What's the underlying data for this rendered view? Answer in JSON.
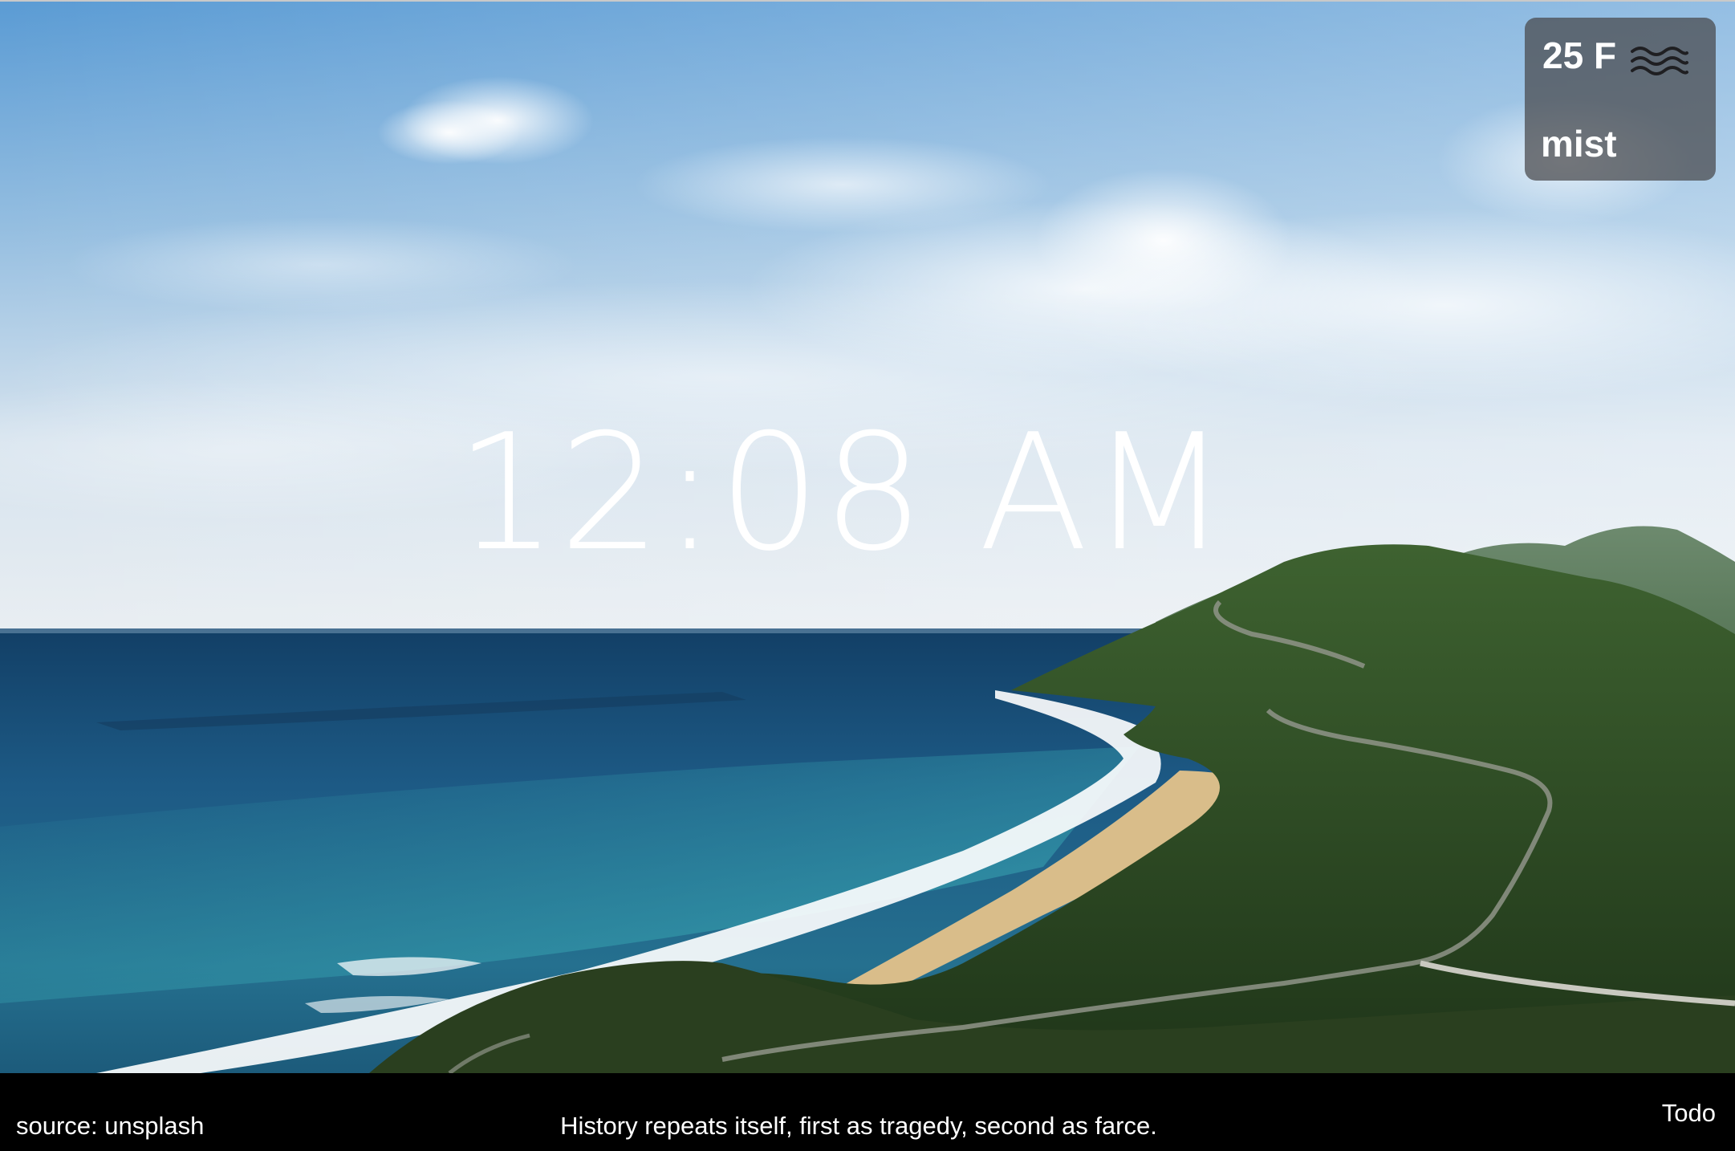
{
  "background": {
    "image": "coastal-landscape",
    "colors": {
      "sky_top": "#5e9fd6",
      "sky_horizon": "#e6edf2",
      "ocean_deep": "#1b4f78",
      "ocean_shallow": "#2f8aa0",
      "surf": "#ffffff",
      "sand": "#d9bd8a",
      "hills": "#2f4d27"
    }
  },
  "weather": {
    "temperature": "25 F",
    "icon": "mist-icon",
    "description": "mist"
  },
  "clock": {
    "time": "12:08 AM"
  },
  "footer": {
    "source": "source: unsplash",
    "quote": "History repeats itself, first as tragedy, second as farce.",
    "todo_label": "Todo"
  }
}
